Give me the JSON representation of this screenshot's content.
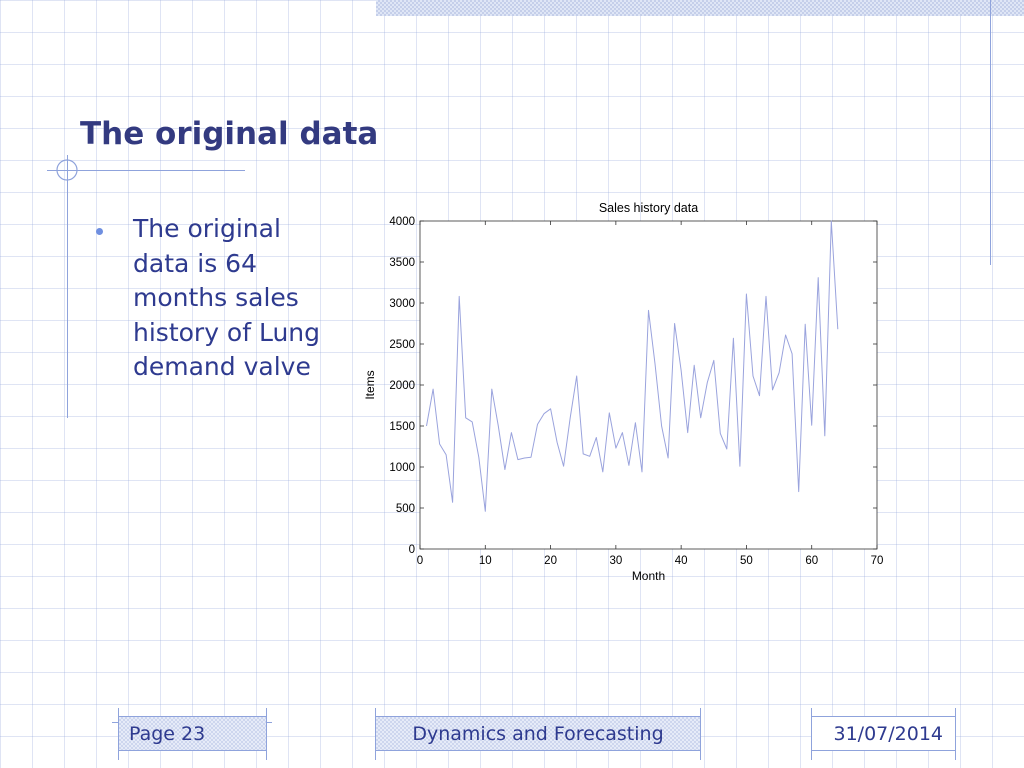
{
  "slide": {
    "title": "The original data",
    "bullet": "The original data is 64 months sales history of Lung demand valve"
  },
  "footer": {
    "page": "Page 23",
    "center": "Dynamics and Forecasting",
    "date": "31/07/2014"
  },
  "colors": {
    "title": "#333a80",
    "body_text": "#2e3a8f",
    "accent_line": "#8fa3dc",
    "series_line": "#9aa3dd"
  },
  "chart_data": {
    "type": "line",
    "title": "Sales history data",
    "xlabel": "Month",
    "ylabel": "Items",
    "xlim": [
      0,
      70
    ],
    "ylim": [
      0,
      4000
    ],
    "xticks": [
      0,
      10,
      20,
      30,
      40,
      50,
      60,
      70
    ],
    "yticks": [
      0,
      500,
      1000,
      1500,
      2000,
      2500,
      3000,
      3500,
      4000
    ],
    "grid": false,
    "series": [
      {
        "x": [
          1,
          2,
          3,
          4,
          5,
          6,
          7,
          8,
          9,
          10,
          11,
          12,
          13,
          14,
          15,
          16,
          17,
          18,
          19,
          20,
          21,
          22,
          23,
          24,
          25,
          26,
          27,
          28,
          29,
          30,
          31,
          32,
          33,
          34,
          35,
          36,
          37,
          38,
          39,
          40,
          41,
          42,
          43,
          44,
          45,
          46,
          47,
          48,
          49,
          50,
          51,
          52,
          53,
          54,
          55,
          56,
          57,
          58,
          59,
          60,
          61,
          62,
          63,
          64
        ],
        "y": [
          1500,
          1950,
          1280,
          1150,
          570,
          3080,
          1600,
          1550,
          1120,
          460,
          1950,
          1500,
          970,
          1420,
          1090,
          1110,
          1120,
          1520,
          1650,
          1710,
          1300,
          1010,
          1600,
          2110,
          1160,
          1130,
          1360,
          940,
          1660,
          1230,
          1420,
          1020,
          1540,
          940,
          2910,
          2260,
          1500,
          1110,
          2750,
          2180,
          1420,
          2240,
          1600,
          2030,
          2300,
          1410,
          1220,
          2570,
          1010,
          3110,
          2110,
          1870,
          3080,
          1940,
          2150,
          2610,
          2380,
          700,
          2740,
          1510,
          3310,
          1380,
          4000,
          2680
        ]
      }
    ]
  }
}
